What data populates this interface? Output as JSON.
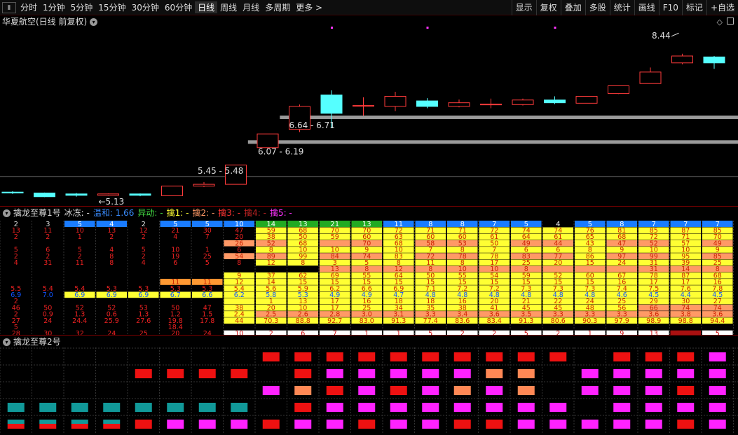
{
  "toolbar": {
    "periods": [
      "分时",
      "1分钟",
      "5分钟",
      "15分钟",
      "30分钟",
      "60分钟",
      "日线",
      "周线",
      "月线",
      "多周期",
      "更多 >"
    ],
    "active_index": 6,
    "right_buttons": [
      "显示",
      "复权",
      "叠加",
      "多股",
      "统计",
      "画线",
      "F10",
      "标记",
      "+自选"
    ]
  },
  "main_chart": {
    "title": "华夏航空(日线 前复权)",
    "colors": {
      "up": "#ff3b3b",
      "down": "#55ffff",
      "zone": "#9a9a9a",
      "dot": "#ff33ff"
    },
    "candles": [
      {
        "o": 5.03,
        "c": 5.01,
        "h": 5.05,
        "l": 4.99
      },
      {
        "o": 5.01,
        "c": 4.93,
        "h": 5.02,
        "l": 4.92
      },
      {
        "o": 4.99,
        "c": 4.96,
        "h": 5.01,
        "l": 4.93
      },
      {
        "o": 4.96,
        "c": 4.99,
        "h": 5.0,
        "l": 4.95
      },
      {
        "o": 4.99,
        "c": 4.96,
        "h": 5.0,
        "l": 4.94
      },
      {
        "o": 4.95,
        "c": 5.16,
        "h": 5.16,
        "l": 4.95
      },
      {
        "o": 5.16,
        "c": 5.2,
        "h": 5.25,
        "l": 5.14
      },
      {
        "o": 5.2,
        "c": 5.62,
        "h": 5.62,
        "l": 5.2
      },
      {
        "o": 6.0,
        "c": 6.3,
        "h": 6.3,
        "l": 5.98
      },
      {
        "o": 6.4,
        "c": 6.9,
        "h": 6.94,
        "l": 6.34
      },
      {
        "o": 7.15,
        "c": 6.75,
        "h": 7.25,
        "l": 6.43
      },
      {
        "o": 6.92,
        "c": 6.92,
        "h": 7.1,
        "l": 6.7
      },
      {
        "o": 6.9,
        "c": 7.12,
        "h": 7.22,
        "l": 6.8
      },
      {
        "o": 7.02,
        "c": 6.9,
        "h": 7.08,
        "l": 6.86
      },
      {
        "o": 6.9,
        "c": 6.98,
        "h": 7.05,
        "l": 6.88
      },
      {
        "o": 6.95,
        "c": 6.95,
        "h": 7.07,
        "l": 6.86
      },
      {
        "o": 6.94,
        "c": 7.04,
        "h": 7.07,
        "l": 6.92
      },
      {
        "o": 7.04,
        "c": 6.98,
        "h": 7.12,
        "l": 6.95
      },
      {
        "o": 6.97,
        "c": 7.12,
        "h": 7.12,
        "l": 6.97
      },
      {
        "o": 7.18,
        "c": 7.35,
        "h": 7.35,
        "l": 7.17
      },
      {
        "o": 7.4,
        "c": 7.65,
        "h": 7.75,
        "l": 7.4
      },
      {
        "o": 7.85,
        "c": 8.0,
        "h": 8.05,
        "l": 7.82
      },
      {
        "o": 7.98,
        "c": 7.85,
        "h": 8.0,
        "l": 7.72
      }
    ],
    "labels": {
      "zone1": "6.64 - 6.71",
      "zone2": "6.07 - 6.19",
      "zone3": "5.45 - 5.48",
      "low_marker": "←5.13",
      "high_marker": "8.44"
    }
  },
  "indicator1": {
    "title": "擒龙至尊1号",
    "items": [
      {
        "label": "冰冻: -",
        "color": "#dddddd"
      },
      {
        "label": "温和: 1.66",
        "color": "#3a8cff"
      },
      {
        "label": "异动: -",
        "color": "#44dd44"
      },
      {
        "label": "擒1: -",
        "color": "#ffff33"
      },
      {
        "label": "擒2: -",
        "color": "#ff9966"
      },
      {
        "label": "擒3: -",
        "color": "#ff3333"
      },
      {
        "label": "擒4: -",
        "color": "#bb2222"
      },
      {
        "label": "擒5: -",
        "color": "#ff33ff"
      }
    ],
    "header_row": [
      "2",
      "3",
      "5",
      "4",
      "2",
      "5",
      "5",
      "10",
      "14",
      "13",
      "21",
      "13",
      "11",
      "8",
      "8",
      "7",
      "5",
      "4",
      "5",
      "8",
      "7",
      "7",
      "7"
    ],
    "row_vals": [
      [
        "13",
        "11",
        "10",
        "13",
        "12",
        "21",
        "30",
        "47",
        "59",
        "68",
        "70",
        "70",
        "72",
        "71",
        "71",
        "72",
        "74",
        "74",
        "76",
        "81",
        "85",
        "87",
        "85"
      ],
      [
        "2",
        "2",
        "1",
        "2",
        "2",
        "4",
        "7",
        "20",
        "38",
        "50",
        "59",
        "60",
        "63",
        "60",
        "60",
        "61",
        "64",
        "61",
        "65",
        "68",
        "72",
        "71",
        "70"
      ],
      [
        "",
        "",
        "",
        "",
        "",
        "",
        "",
        "26",
        "52",
        "68",
        "",
        "70",
        "68",
        "58",
        "53",
        "50",
        "49",
        "44",
        "43",
        "47",
        "52",
        "57",
        "49"
      ],
      [
        "5",
        "6",
        "5",
        "4",
        "5",
        "10",
        "1",
        "6",
        "8",
        "10",
        "10",
        "9",
        "10",
        "7",
        "8",
        "7",
        "6",
        "6",
        "8",
        "9",
        "10",
        "10",
        "9"
      ],
      [
        "2",
        "2",
        "2",
        "8",
        "2",
        "19",
        "25",
        "54",
        "89",
        "99",
        "84",
        "74",
        "83",
        "72",
        "78",
        "78",
        "83",
        "77",
        "86",
        "97",
        "99",
        "95",
        "85"
      ],
      [
        "4",
        "31",
        "11",
        "8",
        "4",
        "6",
        "5",
        "8",
        "12",
        "8",
        "3",
        "5",
        "8",
        "11",
        "8",
        "17",
        "25",
        "20",
        "15",
        "24",
        "31",
        "39",
        "25"
      ],
      [
        "",
        "",
        "",
        "",
        "",
        "",
        "",
        "",
        "",
        "",
        "13",
        "8",
        "12",
        "8",
        "10",
        "10",
        "8",
        "",
        "",
        "",
        "31",
        "14",
        "8"
      ],
      [
        "",
        "",
        "",
        "",
        "",
        "",
        "",
        "9",
        "37",
        "62",
        "69",
        "55",
        "64",
        "50",
        "55",
        "54",
        "59",
        "52",
        "60",
        "67",
        "78",
        "87",
        "68"
      ],
      [
        "",
        "",
        "",
        "",
        "",
        "11",
        "11",
        "12",
        "14",
        "15",
        "15",
        "15",
        "15",
        "15",
        "15",
        "15",
        "15",
        "15",
        "15",
        "16",
        "17",
        "17",
        "16"
      ],
      [
        "5.5",
        "5.4",
        "5.4",
        "5.3",
        "5.3",
        "5.3",
        "5.3",
        "5.4",
        "5.6",
        "5.9",
        "6.2",
        "6.6",
        "6.9",
        "7.1",
        "7.2",
        "7.2",
        "7.3",
        "7.3",
        "7.3",
        "7.4",
        "7.5",
        "7.6",
        "7.8"
      ],
      [
        "6.9",
        "7.0",
        "6.9",
        "6.9",
        "6.9",
        "6.7",
        "6.6",
        "6.2",
        "5.8",
        "5.3",
        "4.9",
        "4.9",
        "4.7",
        "4.8",
        "4.8",
        "4.8",
        "4.8",
        "4.8",
        "4.8",
        "4.6",
        "4.5",
        "4.4",
        "4.5"
      ],
      [
        "2",
        "",
        "",
        "",
        "",
        "",
        "",
        "",
        "1",
        "13",
        "17",
        "16",
        "18",
        "18",
        "16",
        "20",
        "21",
        "22",
        "24",
        "25",
        "29",
        "30",
        "27"
      ],
      [
        "46",
        "50",
        "52",
        "52",
        "53",
        "50",
        "47",
        "38",
        "20",
        "10",
        "17",
        "25",
        "34",
        "35",
        "38",
        "41",
        "45",
        "45",
        "48",
        "56",
        "66",
        "74",
        "74"
      ],
      [
        "2",
        "0.9",
        "1.3",
        "0.6",
        "1.3",
        "1.2",
        "1.5",
        "2.4",
        "2.5",
        "2.6",
        "2.8",
        "3.0",
        "3.1",
        "3.3",
        "3.4",
        "3.6",
        "3.5",
        "3.3",
        "3.3",
        "3.3",
        "3.6",
        "3.8",
        "3.6"
      ],
      [
        "27",
        "24",
        "24.4",
        "25.9",
        "27.6",
        "19.8",
        "17.8",
        "44",
        "70.3",
        "88.8",
        "92.7",
        "83.0",
        "91.3",
        "77.4",
        "83.6",
        "83.4",
        "91.3",
        "80.6",
        "90.3",
        "97.9",
        "98.9",
        "98.8",
        "94.4"
      ],
      [
        "5",
        "",
        "",
        "",
        "",
        "18.4",
        "",
        "",
        "",
        "",
        "",
        "",
        "",
        "",
        "",
        "",
        "",
        "",
        "",
        "",
        "",
        "",
        ""
      ],
      [
        "28",
        "30",
        "32",
        "24",
        "25",
        "20",
        "24",
        "10",
        "2",
        "6",
        "7",
        "1",
        "1",
        "5",
        "2",
        "2",
        "5",
        "2",
        "1",
        "9",
        "13",
        "",
        "5"
      ]
    ]
  },
  "indicator2": {
    "title": "擒龙至尊2号",
    "colors": {
      "R": "#ee1111",
      "M": "#ff22ff",
      "O": "#ff8855",
      "T": "#119999"
    },
    "rows": [
      "........RRRRRRRRRR.RRRMO",
      "....RRRR.RMMMMMOO.MMMMMM",
      "........MORMRMOMO.MMMRMM",
      "TTTTTTTT.RMMMMMMMM.MMMMMM",
      "SSSSRMMMRMMRMMRRMMMMMRMM"
    ]
  }
}
